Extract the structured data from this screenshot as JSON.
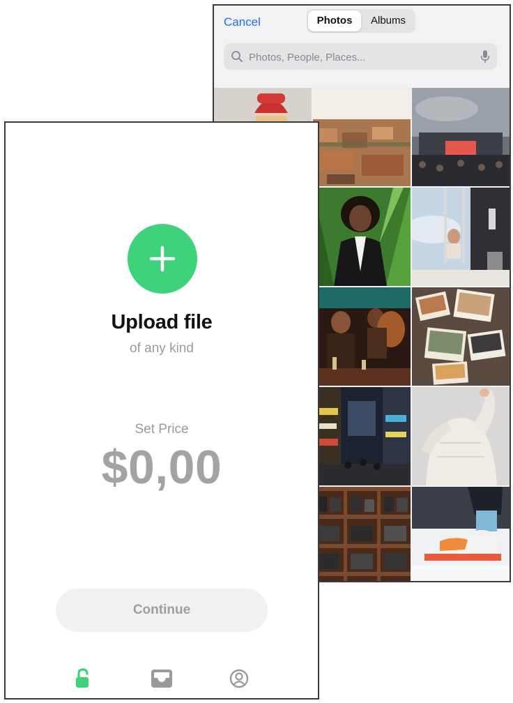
{
  "picker": {
    "cancel_label": "Cancel",
    "tabs": [
      {
        "label": "Photos",
        "active": true
      },
      {
        "label": "Albums",
        "active": false
      }
    ],
    "search": {
      "placeholder": "Photos, People, Places...",
      "value": ""
    },
    "photos": [
      "woman-red-hat-photo",
      "city-rooftops-photo",
      "concert-crowd-photo",
      "woman-black-blazer-photo",
      "woman-sitting-ladder-photo",
      "bar-people-photo",
      "scattered-photos-photo",
      "neon-street-night-photo",
      "knit-sweater-photo",
      "camera-shelves-photo",
      "sneaker-snow-photo"
    ]
  },
  "upload": {
    "title": "Upload file",
    "subtitle": "of any kind",
    "price_label": "Set Price",
    "price_value": "$0,00",
    "continue_label": "Continue"
  },
  "tabbar": {
    "items": [
      {
        "icon": "unlock-icon",
        "active": true
      },
      {
        "icon": "inbox-icon",
        "active": false
      },
      {
        "icon": "profile-icon",
        "active": false
      }
    ]
  },
  "colors": {
    "accent_green": "#3ED27A",
    "ios_blue": "#1A73E8",
    "muted_gray": "#A3A3A3"
  }
}
